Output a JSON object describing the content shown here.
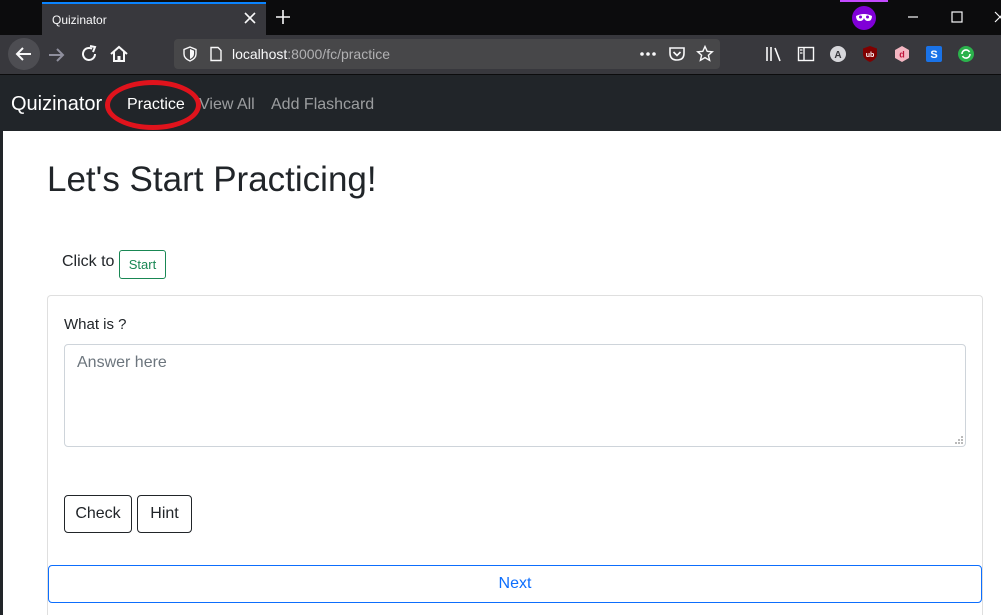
{
  "browser": {
    "tab_title": "Quizinator",
    "url_host": "localhost",
    "url_rest": ":8000/fc/practice"
  },
  "app": {
    "brand": "Quizinator",
    "nav": [
      {
        "label": "Practice",
        "active": true
      },
      {
        "label": "View All",
        "active": false
      },
      {
        "label": "Add Flashcard",
        "active": false
      }
    ]
  },
  "main": {
    "heading": "Let's Start Practicing!",
    "click_to": "Click to",
    "start_label": "Start",
    "question": "What is ?",
    "answer_placeholder": "Answer here",
    "check_label": "Check",
    "hint_label": "Hint",
    "next_label": "Next"
  },
  "colors": {
    "annotation": "#e0131c",
    "navbar_bg": "#212529",
    "success": "#198754",
    "primary": "#0d6efd"
  }
}
